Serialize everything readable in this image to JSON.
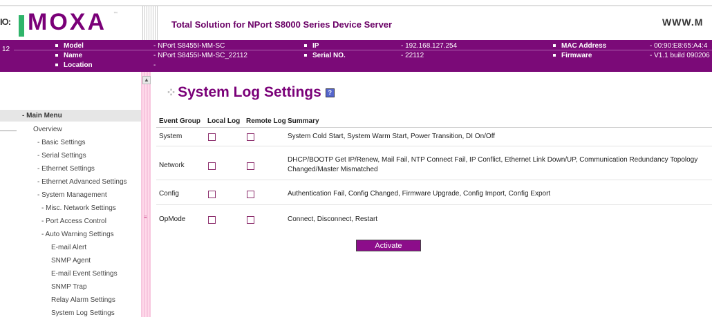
{
  "header": {
    "logo_left": "IO:",
    "logo": "MOXA",
    "title": "Total Solution for NPort S8000 Series Device Server",
    "url": "www.m"
  },
  "info": {
    "model_label": "Model",
    "model_value": "- NPort S8455I-MM-SC",
    "name_label": "Name",
    "name_value": "- NPort S8455I-MM-SC_22112",
    "location_label": "Location",
    "location_value": "-",
    "ip_label": "IP",
    "ip_value": "- 192.168.127.254",
    "serial_label": "Serial NO.",
    "serial_value": "- 22112",
    "mac_label": "MAC Address",
    "mac_value": "- 00:90:E8:65:A4:4",
    "firmware_label": "Firmware",
    "firmware_value": "- V1.1 build 090206",
    "left_num": "12"
  },
  "sidebar": {
    "head": "- Main Menu",
    "items": [
      "Overview",
      "- Basic Settings",
      "- Serial Settings",
      "- Ethernet Settings",
      "- Ethernet Advanced Settings",
      "- System Management",
      "- Misc. Network Settings",
      "- Port Access Control",
      "- Auto Warning Settings",
      "E-mail Alert",
      "SNMP Agent",
      "E-mail Event Settings",
      "SNMP Trap",
      "Relay Alarm Settings",
      "System Log Settings"
    ]
  },
  "main": {
    "title": "System Log Settings",
    "help": "?",
    "columns": [
      "Event Group",
      "Local Log",
      "Remote Log",
      "Summary"
    ],
    "rows": [
      {
        "group": "System",
        "summary1": "System Cold Start, System Warm Start, Power Transition, DI On/Off",
        "summary2": ""
      },
      {
        "group": "Network",
        "summary1": "DHCP/BOOTP Get IP/Renew, Mail Fail, NTP Connect Fail, IP Conflict, Ethernet Link Down/UP, Communication Redundancy Topology",
        "summary2": "Changed/Master Mismatched"
      },
      {
        "group": "Config",
        "summary1": "Authentication Fail, Config Changed, Firmware Upgrade, Config Import, Config Export",
        "summary2": ""
      },
      {
        "group": "OpMode",
        "summary1": "Connect, Disconnect, Restart",
        "summary2": ""
      }
    ],
    "activate": "Activate"
  }
}
